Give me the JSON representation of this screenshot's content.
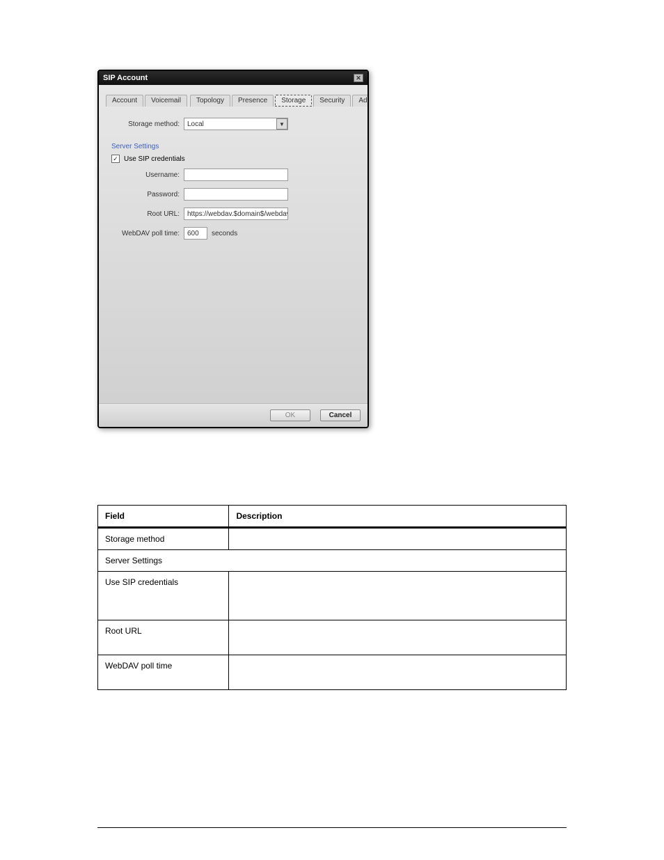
{
  "dialog": {
    "title": "SIP Account",
    "tabs": {
      "account": "Account",
      "voicemail": "Voicemail",
      "topology": "Topology",
      "presence": "Presence",
      "storage": "Storage",
      "security": "Security",
      "advanced": "Advanced"
    },
    "storage_method_label": "Storage method:",
    "storage_method_value": "Local",
    "server_settings_legend": "Server Settings",
    "use_sip_credentials_label": "Use SIP credentials",
    "use_sip_credentials_checked": "✓",
    "username_label": "Username:",
    "username_value": "",
    "password_label": "Password:",
    "password_value": "",
    "root_url_label": "Root URL:",
    "root_url_value": "https://webdav.$domain$/webdav/$use",
    "webdav_poll_time_label": "WebDAV poll time:",
    "webdav_poll_time_value": "600",
    "webdav_poll_time_unit": "seconds",
    "ok_label": "OK",
    "cancel_label": "Cancel"
  },
  "table": {
    "header_field": "Field",
    "header_description": "Description",
    "rows": [
      {
        "field": "Storage method",
        "desc": ""
      },
      {
        "field": "Server Settings",
        "desc": "",
        "span": true
      },
      {
        "field": "Use SIP credentials",
        "desc": ""
      },
      {
        "field": "Root URL",
        "desc": ""
      },
      {
        "field": "WebDAV poll time",
        "desc": ""
      }
    ]
  }
}
